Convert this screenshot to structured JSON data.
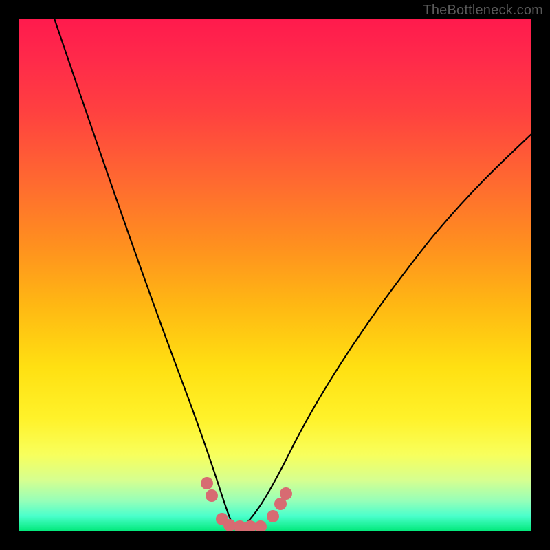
{
  "watermark": "TheBottleneck.com",
  "chart_data": {
    "type": "line",
    "title": "",
    "xlabel": "",
    "ylabel": "",
    "xlim": [
      0,
      100
    ],
    "ylim": [
      0,
      100
    ],
    "grid": false,
    "legend": false,
    "series": [
      {
        "name": "left-curve",
        "x": [
          7,
          12,
          18,
          24,
          29,
          32,
          34,
          36,
          38,
          40,
          42
        ],
        "y": [
          100,
          80,
          58,
          38,
          22,
          13,
          8,
          5,
          3,
          1,
          0
        ]
      },
      {
        "name": "right-curve",
        "x": [
          42,
          45,
          48,
          52,
          58,
          66,
          76,
          88,
          100
        ],
        "y": [
          0,
          1,
          3,
          8,
          18,
          32,
          48,
          64,
          78
        ]
      }
    ],
    "markers": {
      "name": "bottom-dots",
      "color": "#d76b72",
      "points": [
        {
          "x": 36.5,
          "y": 9.5
        },
        {
          "x": 37.5,
          "y": 7.0
        },
        {
          "x": 39.5,
          "y": 2.5
        },
        {
          "x": 41.0,
          "y": 1.3
        },
        {
          "x": 43.0,
          "y": 1.0
        },
        {
          "x": 45.0,
          "y": 1.0
        },
        {
          "x": 47.0,
          "y": 1.0
        },
        {
          "x": 49.5,
          "y": 3.0
        },
        {
          "x": 51.0,
          "y": 5.5
        },
        {
          "x": 52.0,
          "y": 7.5
        }
      ]
    },
    "background_gradient": {
      "top": "#ff1a4d",
      "bottom": "#00e878"
    }
  }
}
